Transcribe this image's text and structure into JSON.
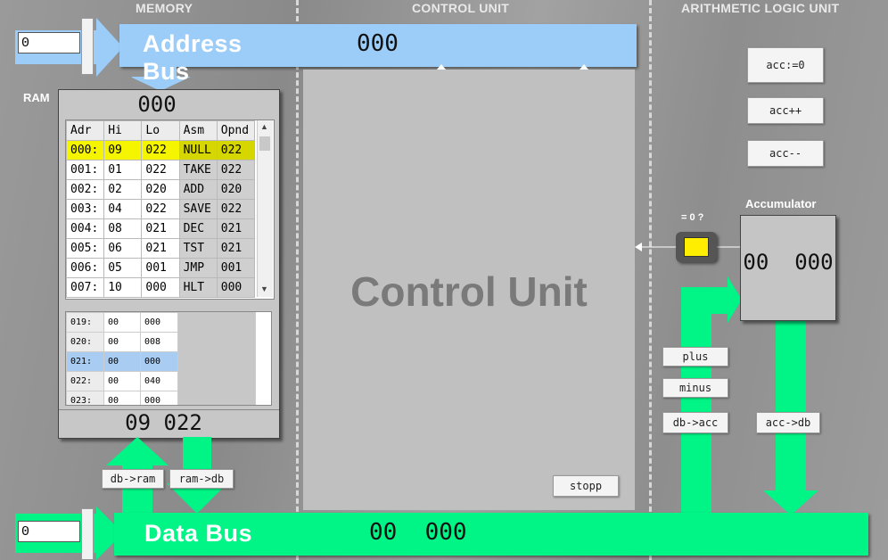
{
  "sections": {
    "memory": "MEMORY",
    "control_unit": "CONTROL UNIT",
    "alu": "ARITHMETIC LOGIC UNIT"
  },
  "address_bus": {
    "label": "Address Bus",
    "value": "000",
    "input_value": "0"
  },
  "data_bus": {
    "label": "Data Bus",
    "value": "00  000",
    "input_value": "0"
  },
  "ram": {
    "label": "RAM",
    "address_display": "000",
    "data_display": "09  022",
    "columns": [
      "Adr",
      "Hi",
      "Lo",
      "Asm",
      "Opnd"
    ],
    "rows": [
      {
        "adr": "000:",
        "hi": "09",
        "lo": "022",
        "asm": "NULL",
        "opnd": "022"
      },
      {
        "adr": "001:",
        "hi": "01",
        "lo": "022",
        "asm": "TAKE",
        "opnd": "022"
      },
      {
        "adr": "002:",
        "hi": "02",
        "lo": "020",
        "asm": "ADD",
        "opnd": "020"
      },
      {
        "adr": "003:",
        "hi": "04",
        "lo": "022",
        "asm": "SAVE",
        "opnd": "022"
      },
      {
        "adr": "004:",
        "hi": "08",
        "lo": "021",
        "asm": "DEC",
        "opnd": "021"
      },
      {
        "adr": "005:",
        "hi": "06",
        "lo": "021",
        "asm": "TST",
        "opnd": "021"
      },
      {
        "adr": "006:",
        "hi": "05",
        "lo": "001",
        "asm": "JMP",
        "opnd": "001"
      },
      {
        "adr": "007:",
        "hi": "10",
        "lo": "000",
        "asm": "HLT",
        "opnd": "000"
      }
    ],
    "data_rows": [
      {
        "adr": "019:",
        "hi": "00",
        "lo": "000"
      },
      {
        "adr": "020:",
        "hi": "00",
        "lo": "008"
      },
      {
        "adr": "021:",
        "hi": "00",
        "lo": "000"
      },
      {
        "adr": "022:",
        "hi": "00",
        "lo": "040"
      },
      {
        "adr": "023:",
        "hi": "00",
        "lo": "000"
      }
    ],
    "scroll_up": "▲",
    "scroll_down": "▼"
  },
  "buttons": {
    "db_to_ram": "db->ram",
    "ram_to_db": "ram->db",
    "stopp": "stopp",
    "acc_zero": "acc:=0",
    "acc_inc": "acc++",
    "acc_dec": "acc--",
    "plus": "plus",
    "minus": "minus",
    "db_to_acc": "db->acc",
    "acc_to_db": "acc->db"
  },
  "control_unit": {
    "label": "Control Unit"
  },
  "alu": {
    "zero_test_label": "= 0 ?",
    "accumulator_label": "Accumulator",
    "accumulator_value": "00  000"
  },
  "colors": {
    "address_bus": "#9bcdf8",
    "data_bus": "#00f486",
    "zero_flag": "#ffee00",
    "selected_row": "#f5f500"
  }
}
